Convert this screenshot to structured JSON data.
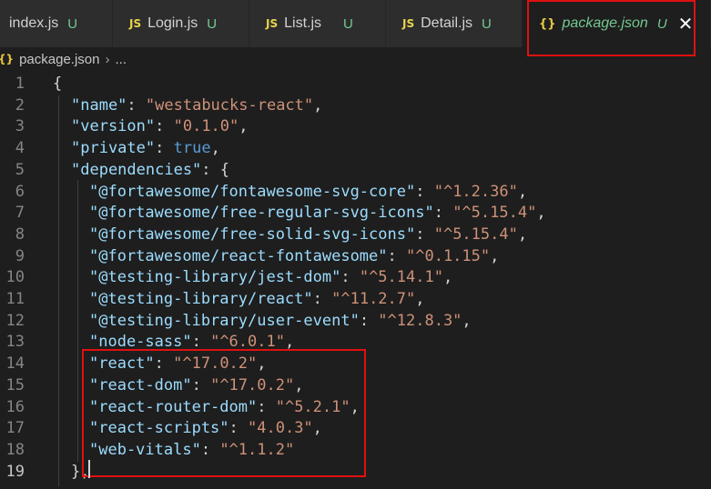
{
  "tabs": [
    {
      "icon": "JS",
      "name": "index.js",
      "flag": "U"
    },
    {
      "icon": "JS",
      "name": "Login.js",
      "flag": "U"
    },
    {
      "icon": "JS",
      "name": "List.js",
      "flag": "U"
    },
    {
      "icon": "JS",
      "name": "Detail.js",
      "flag": "U"
    },
    {
      "icon": "{}",
      "name": "package.json",
      "flag": "U",
      "close": "✕"
    }
  ],
  "breadcrumb": {
    "icon": "{}",
    "file": "package.json",
    "sep": "›",
    "more": "..."
  },
  "lines": [
    {
      "n": "1",
      "t": [
        [
          "p",
          "{"
        ]
      ]
    },
    {
      "n": "2",
      "t": [
        [
          "k",
          "\"name\""
        ],
        [
          "p",
          ": "
        ],
        [
          "s",
          "\"westabucks-react\""
        ],
        [
          "p",
          ","
        ]
      ]
    },
    {
      "n": "3",
      "t": [
        [
          "k",
          "\"version\""
        ],
        [
          "p",
          ": "
        ],
        [
          "s",
          "\"0.1.0\""
        ],
        [
          "p",
          ","
        ]
      ]
    },
    {
      "n": "4",
      "t": [
        [
          "k",
          "\"private\""
        ],
        [
          "p",
          ": "
        ],
        [
          "b",
          "true"
        ],
        [
          "p",
          ","
        ]
      ]
    },
    {
      "n": "5",
      "t": [
        [
          "k",
          "\"dependencies\""
        ],
        [
          "p",
          ": {"
        ]
      ]
    },
    {
      "n": "6",
      "t": [
        [
          "k",
          "\"@fortawesome/fontawesome-svg-core\""
        ],
        [
          "p",
          ": "
        ],
        [
          "s",
          "\"^1.2.36\""
        ],
        [
          "p",
          ","
        ]
      ]
    },
    {
      "n": "7",
      "t": [
        [
          "k",
          "\"@fortawesome/free-regular-svg-icons\""
        ],
        [
          "p",
          ": "
        ],
        [
          "s",
          "\"^5.15.4\""
        ],
        [
          "p",
          ","
        ]
      ]
    },
    {
      "n": "8",
      "t": [
        [
          "k",
          "\"@fortawesome/free-solid-svg-icons\""
        ],
        [
          "p",
          ": "
        ],
        [
          "s",
          "\"^5.15.4\""
        ],
        [
          "p",
          ","
        ]
      ]
    },
    {
      "n": "9",
      "t": [
        [
          "k",
          "\"@fortawesome/react-fontawesome\""
        ],
        [
          "p",
          ": "
        ],
        [
          "s",
          "\"^0.1.15\""
        ],
        [
          "p",
          ","
        ]
      ]
    },
    {
      "n": "10",
      "t": [
        [
          "k",
          "\"@testing-library/jest-dom\""
        ],
        [
          "p",
          ": "
        ],
        [
          "s",
          "\"^5.14.1\""
        ],
        [
          "p",
          ","
        ]
      ]
    },
    {
      "n": "11",
      "t": [
        [
          "k",
          "\"@testing-library/react\""
        ],
        [
          "p",
          ": "
        ],
        [
          "s",
          "\"^11.2.7\""
        ],
        [
          "p",
          ","
        ]
      ]
    },
    {
      "n": "12",
      "t": [
        [
          "k",
          "\"@testing-library/user-event\""
        ],
        [
          "p",
          ": "
        ],
        [
          "s",
          "\"^12.8.3\""
        ],
        [
          "p",
          ","
        ]
      ]
    },
    {
      "n": "13",
      "t": [
        [
          "k",
          "\"node-sass\""
        ],
        [
          "p",
          ": "
        ],
        [
          "s",
          "\"^6.0.1\""
        ],
        [
          "p",
          ","
        ]
      ]
    },
    {
      "n": "14",
      "t": [
        [
          "k",
          "\"react\""
        ],
        [
          "p",
          ": "
        ],
        [
          "s",
          "\"^17.0.2\""
        ],
        [
          "p",
          ","
        ]
      ]
    },
    {
      "n": "15",
      "t": [
        [
          "k",
          "\"react-dom\""
        ],
        [
          "p",
          ": "
        ],
        [
          "s",
          "\"^17.0.2\""
        ],
        [
          "p",
          ","
        ]
      ]
    },
    {
      "n": "16",
      "t": [
        [
          "k",
          "\"react-router-dom\""
        ],
        [
          "p",
          ": "
        ],
        [
          "s",
          "\"^5.2.1\""
        ],
        [
          "p",
          ","
        ]
      ]
    },
    {
      "n": "17",
      "t": [
        [
          "k",
          "\"react-scripts\""
        ],
        [
          "p",
          ": "
        ],
        [
          "s",
          "\"4.0.3\""
        ],
        [
          "p",
          ","
        ]
      ]
    },
    {
      "n": "18",
      "t": [
        [
          "k",
          "\"web-vitals\""
        ],
        [
          "p",
          ": "
        ],
        [
          "s",
          "\"^1.1.2\""
        ]
      ]
    },
    {
      "n": "19",
      "t": [
        [
          "p",
          "},"
        ]
      ]
    }
  ],
  "colors": {
    "highlight": "#e01010",
    "string": "#ce9178",
    "key": "#9cdcfe",
    "keyword": "#569cd6",
    "untracked": "#73c991"
  }
}
